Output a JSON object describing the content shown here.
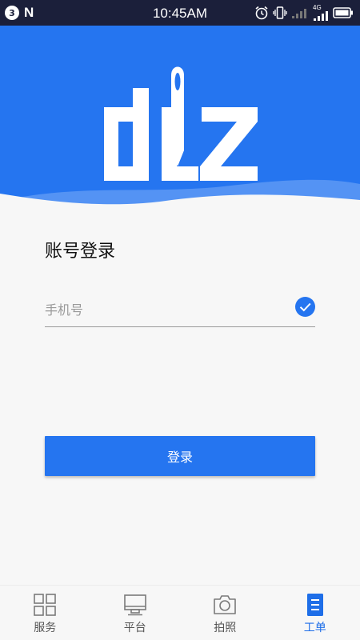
{
  "status_bar": {
    "notification_count": "3",
    "time": "10:45AM",
    "network_label": "4G"
  },
  "header": {
    "background_color": "#2575f0",
    "logo_icon": "needle-logo-icon"
  },
  "login": {
    "title": "账号登录",
    "phone_placeholder": "手机号",
    "phone_value": "",
    "submit_label": "登录"
  },
  "bottom_nav": {
    "items": [
      {
        "label": "服务",
        "icon": "grid-icon",
        "active": false
      },
      {
        "label": "平台",
        "icon": "monitor-icon",
        "active": false
      },
      {
        "label": "拍照",
        "icon": "camera-icon",
        "active": false
      },
      {
        "label": "工单",
        "icon": "document-icon",
        "active": true
      }
    ]
  },
  "colors": {
    "accent": "#2575f0",
    "active_nav": "#1e6ee8",
    "status_bar": "#1b1f3a"
  }
}
